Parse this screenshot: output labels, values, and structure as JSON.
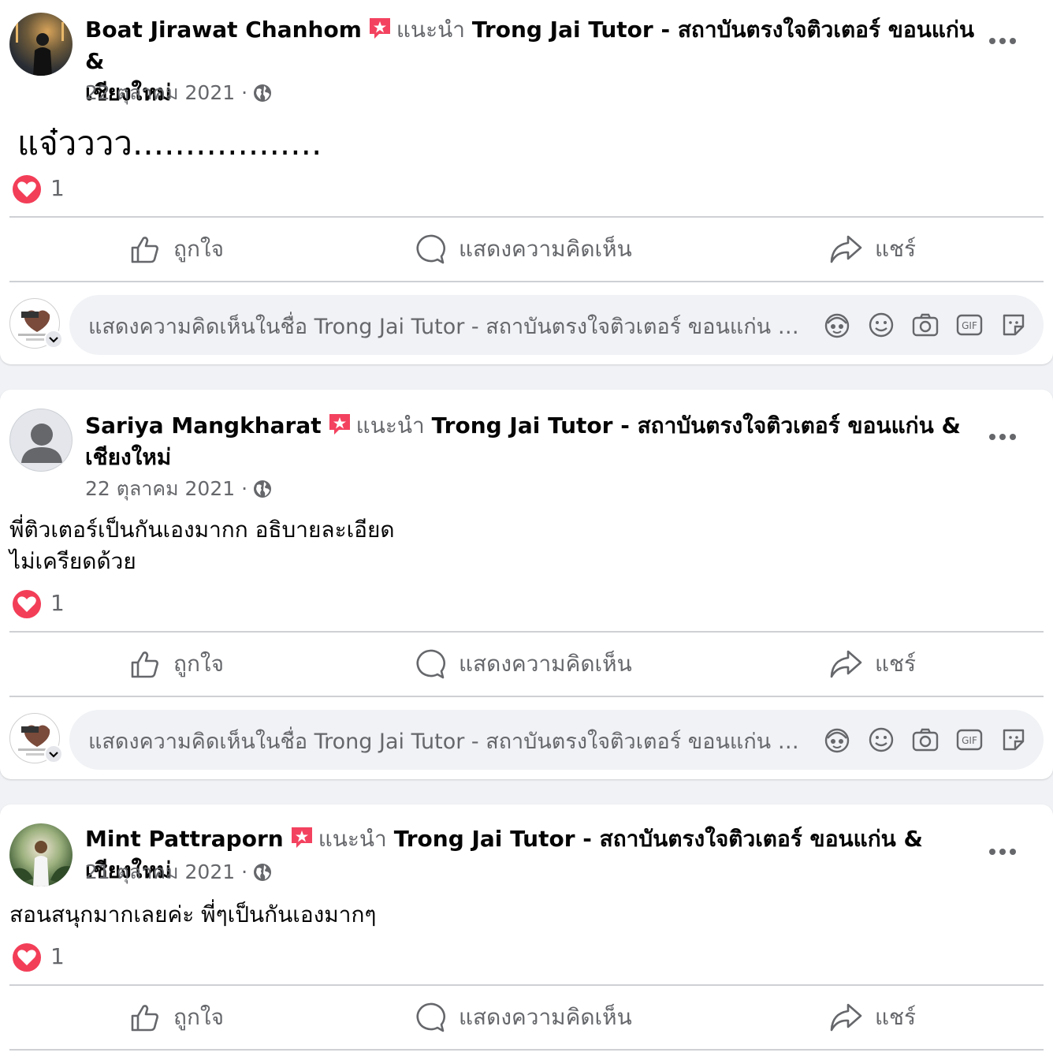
{
  "posts": [
    {
      "author": "Boat Jirawat Chanhom",
      "recommends": "แนะนำ",
      "page": "Trong Jai Tutor - สถาบันตรงใจติวเตอร์ ขอนแก่น &",
      "page_cont": "เชียงใหม่",
      "date": "22 ตุลาคม 2021 ·",
      "text": "แจ๋วววว..................",
      "reaction_count": "1"
    },
    {
      "author": "Sariya Mangkharat",
      "recommends": "แนะนำ",
      "page": "Trong Jai Tutor - สถาบันตรงใจติวเตอร์ ขอนแก่น &",
      "page_cont": "เชียงใหม่",
      "date": "22 ตุลาคม 2021 ·",
      "text_line1": "พี่ติวเตอร์เป็นกันเองมากก อธิบายละเอียด",
      "text_line2": "ไม่เครียดด้วย",
      "reaction_count": "1"
    },
    {
      "author": "Mint Pattraporn",
      "recommends": "แนะนำ",
      "page": "Trong Jai Tutor - สถาบันตรงใจติวเตอร์ ขอนแก่น & เชียงใหม่",
      "date": "21 ตุลาคม 2021 ·",
      "text": "สอนสนุกมากเลยค่ะ พี่ๆเป็นกันเองมากๆ",
      "reaction_count": "1"
    }
  ],
  "actions": {
    "like": "ถูกใจ",
    "comment": "แสดงความคิดเห็น",
    "share": "แชร์"
  },
  "composer": {
    "placeholder": "แสดงความคิดเห็นในชื่อ Trong Jai Tutor - สถาบันตรงใจติวเตอร์ ขอนแก่น & เชียงใหม่"
  },
  "colors": {
    "recommend_badge": "#f3425f",
    "heart": "#f33e58",
    "secondary_text": "#65676b",
    "divider": "#ced0d4"
  },
  "icons": [
    "recommend-badge-icon",
    "globe-icon",
    "more-icon",
    "heart-reaction-icon",
    "like-icon",
    "comment-icon",
    "share-icon",
    "avatar-sticker-icon",
    "emoji-icon",
    "camera-icon",
    "gif-icon",
    "sticker-icon"
  ]
}
